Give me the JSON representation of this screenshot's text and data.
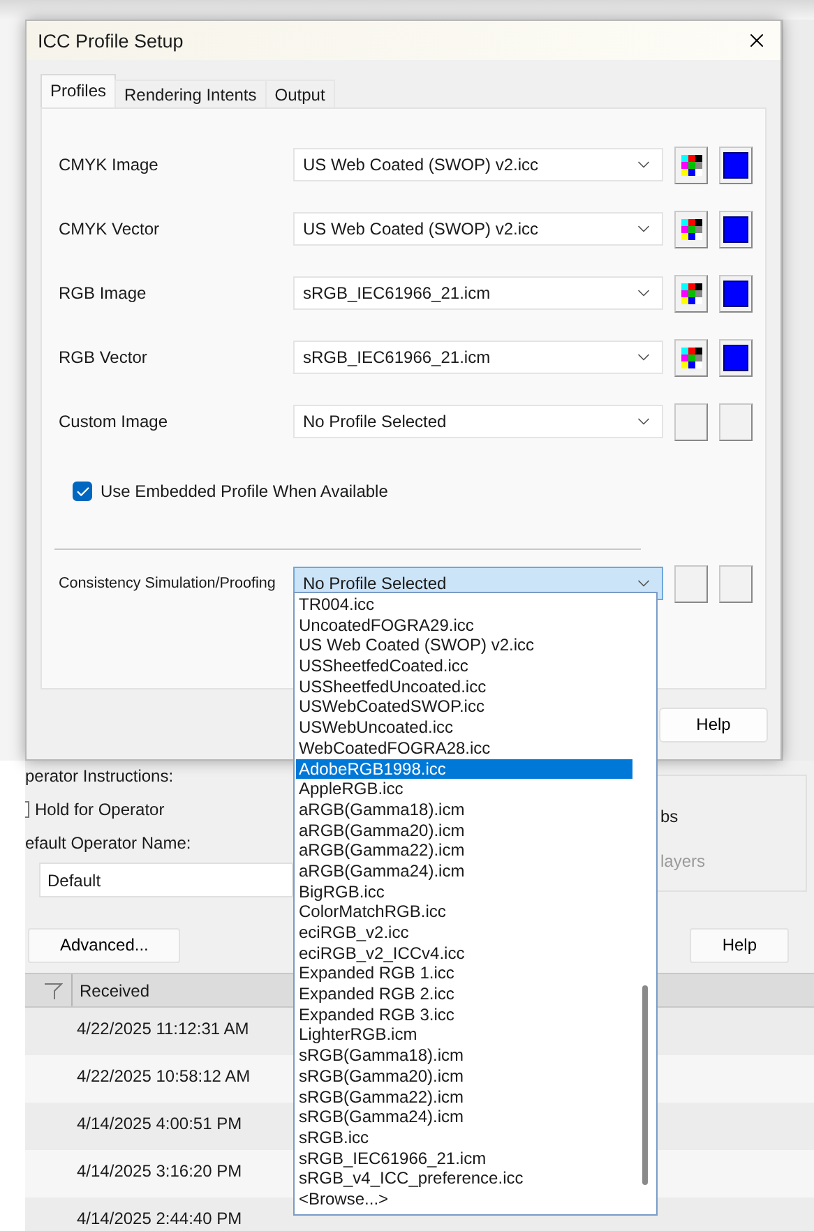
{
  "window": {
    "title": "ICC Profile Setup"
  },
  "tabs": [
    {
      "label": "Profiles",
      "selected": true
    },
    {
      "label": "Rendering Intents",
      "selected": false
    },
    {
      "label": "Output",
      "selected": false
    }
  ],
  "profiles": [
    {
      "label": "CMYK Image",
      "value": "US Web Coated (SWOP) v2.icc",
      "swatches": true
    },
    {
      "label": "CMYK Vector",
      "value": "US Web Coated (SWOP) v2.icc",
      "swatches": true
    },
    {
      "label": "RGB Image",
      "value": "sRGB_IEC61966_21.icm",
      "swatches": true
    },
    {
      "label": "RGB Vector",
      "value": "sRGB_IEC61966_21.icm",
      "swatches": true
    },
    {
      "label": "Custom Image",
      "value": "No Profile Selected",
      "swatches": false
    }
  ],
  "embedded": {
    "label": "Use Embedded Profile When Available",
    "checked": true
  },
  "proofing": {
    "label": "Consistency Simulation/Proofing",
    "value": "No Profile Selected",
    "swatches": false,
    "expanded": true
  },
  "dropdown_items": [
    {
      "label": "TR004.icc",
      "selected": false
    },
    {
      "label": "UncoatedFOGRA29.icc",
      "selected": false
    },
    {
      "label": "US Web Coated (SWOP) v2.icc",
      "selected": false
    },
    {
      "label": "USSheetfedCoated.icc",
      "selected": false
    },
    {
      "label": "USSheetfedUncoated.icc",
      "selected": false
    },
    {
      "label": "USWebCoatedSWOP.icc",
      "selected": false
    },
    {
      "label": "USWebUncoated.icc",
      "selected": false
    },
    {
      "label": "WebCoatedFOGRA28.icc",
      "selected": false
    },
    {
      "label": "AdobeRGB1998.icc",
      "selected": true
    },
    {
      "label": "AppleRGB.icc",
      "selected": false
    },
    {
      "label": "aRGB(Gamma18).icm",
      "selected": false
    },
    {
      "label": "aRGB(Gamma20).icm",
      "selected": false
    },
    {
      "label": "aRGB(Gamma22).icm",
      "selected": false
    },
    {
      "label": "aRGB(Gamma24).icm",
      "selected": false
    },
    {
      "label": "BigRGB.icc",
      "selected": false
    },
    {
      "label": "ColorMatchRGB.icc",
      "selected": false
    },
    {
      "label": "eciRGB_v2.icc",
      "selected": false
    },
    {
      "label": "eciRGB_v2_ICCv4.icc",
      "selected": false
    },
    {
      "label": "Expanded RGB 1.icc",
      "selected": false
    },
    {
      "label": "Expanded RGB 2.icc",
      "selected": false
    },
    {
      "label": "Expanded RGB 3.icc",
      "selected": false
    },
    {
      "label": "LighterRGB.icm",
      "selected": false
    },
    {
      "label": "sRGB(Gamma18).icm",
      "selected": false
    },
    {
      "label": "sRGB(Gamma20).icm",
      "selected": false
    },
    {
      "label": "sRGB(Gamma22).icm",
      "selected": false
    },
    {
      "label": "sRGB(Gamma24).icm",
      "selected": false
    },
    {
      "label": "sRGB.icc",
      "selected": false
    },
    {
      "label": "sRGB_IEC61966_21.icm",
      "selected": false
    },
    {
      "label": "sRGB_v4_ICC_preference.icc",
      "selected": false
    },
    {
      "label": "<Browse...>",
      "selected": false
    }
  ],
  "dialog_buttons": [
    "Help"
  ],
  "background": {
    "instructions_label": "perator Instructions:",
    "hold": {
      "label": "Hold for Operator",
      "checked": false
    },
    "name_label": "efault Operator Name:",
    "name_value": "Default",
    "jobs_label": "bs",
    "layers": {
      "label": "layers",
      "disabled": true
    },
    "buttons": [
      "Advanced...",
      "Help"
    ],
    "table": {
      "columns": [
        "Received"
      ],
      "rows": [
        "4/22/2025 11:12:31 AM",
        "4/22/2025 10:58:12 AM",
        "4/14/2025 4:00:51 PM",
        "4/14/2025 3:16:20 PM",
        "4/14/2025 2:44:40 PM"
      ]
    }
  }
}
